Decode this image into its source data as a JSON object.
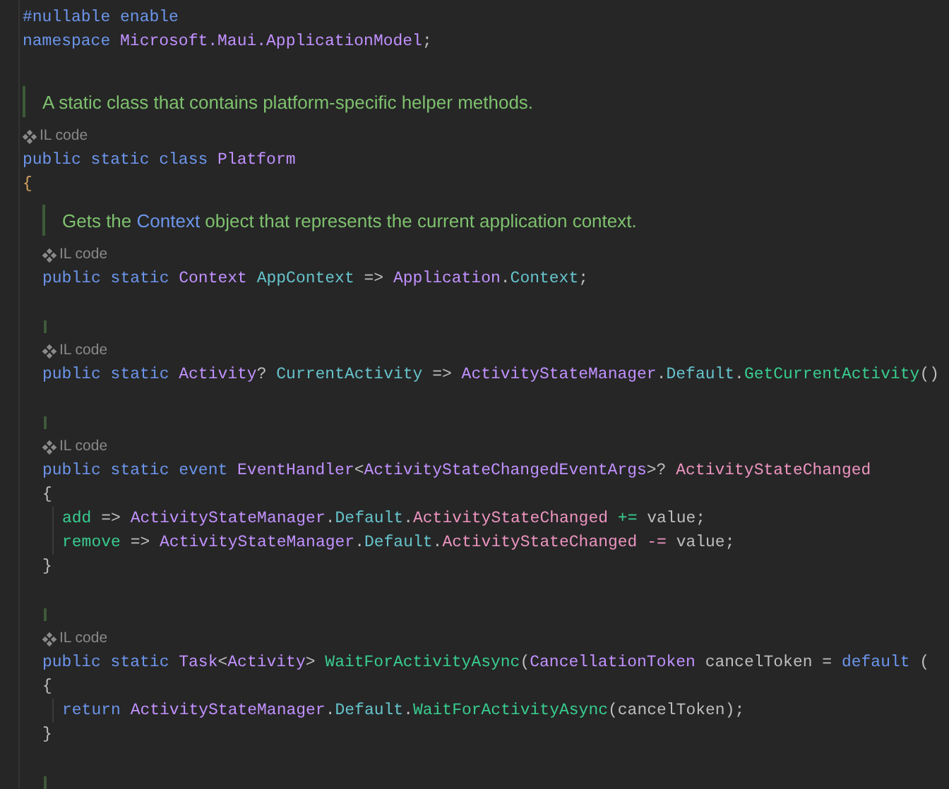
{
  "lines": [
    {
      "kind": "code",
      "tokens": [
        {
          "kind": "keyword",
          "text": "#nullable enable"
        }
      ]
    },
    {
      "kind": "code",
      "tokens": [
        {
          "kind": "keyword",
          "text": "namespace "
        },
        {
          "kind": "type",
          "text": "Microsoft.Maui.ApplicationModel"
        },
        {
          "kind": "plain",
          "text": ";"
        }
      ]
    },
    {
      "kind": "blank"
    },
    {
      "kind": "doc",
      "tokens": [
        {
          "kind": "text",
          "text": "A static class that contains platform-specific helper methods."
        }
      ]
    },
    {
      "kind": "hint",
      "text": "IL code"
    },
    {
      "kind": "code",
      "tokens": [
        {
          "kind": "keyword",
          "text": "public static class "
        },
        {
          "kind": "type",
          "text": "Platform"
        }
      ]
    },
    {
      "kind": "code",
      "tokens": [
        {
          "kind": "brace",
          "text": "{"
        }
      ]
    },
    {
      "kind": "block",
      "children": [
        {
          "kind": "doc",
          "tokens": [
            {
              "kind": "text",
              "text": "Gets the "
            },
            {
              "kind": "link",
              "text": "Context"
            },
            {
              "kind": "text",
              "text": " object that represents the current application context."
            }
          ]
        },
        {
          "kind": "hint",
          "text": "IL code"
        },
        {
          "kind": "code",
          "tokens": [
            {
              "kind": "keyword",
              "text": "public static "
            },
            {
              "kind": "type",
              "text": "Context "
            },
            {
              "kind": "member",
              "text": "AppContext"
            },
            {
              "kind": "plain",
              "text": " => "
            },
            {
              "kind": "type",
              "text": "Application"
            },
            {
              "kind": "plain",
              "text": "."
            },
            {
              "kind": "member",
              "text": "Context"
            },
            {
              "kind": "plain",
              "text": ";"
            }
          ]
        },
        {
          "kind": "blank"
        },
        {
          "kind": "marker"
        },
        {
          "kind": "hint",
          "text": "IL code"
        },
        {
          "kind": "code",
          "tokens": [
            {
              "kind": "keyword",
              "text": "public static "
            },
            {
              "kind": "type",
              "text": "Activity"
            },
            {
              "kind": "plain",
              "text": "? "
            },
            {
              "kind": "member",
              "text": "CurrentActivity"
            },
            {
              "kind": "plain",
              "text": " => "
            },
            {
              "kind": "type",
              "text": "ActivityStateManager"
            },
            {
              "kind": "plain",
              "text": "."
            },
            {
              "kind": "member",
              "text": "Default"
            },
            {
              "kind": "plain",
              "text": "."
            },
            {
              "kind": "method",
              "text": "GetCurrentActivity"
            },
            {
              "kind": "plain",
              "text": "()"
            }
          ]
        },
        {
          "kind": "blank"
        },
        {
          "kind": "marker"
        },
        {
          "kind": "hint",
          "text": "IL code"
        },
        {
          "kind": "code",
          "tokens": [
            {
              "kind": "keyword",
              "text": "public static event "
            },
            {
              "kind": "type",
              "text": "EventHandler"
            },
            {
              "kind": "plain",
              "text": "<"
            },
            {
              "kind": "type",
              "text": "ActivityStateChangedEventArgs"
            },
            {
              "kind": "plain",
              "text": ">? "
            },
            {
              "kind": "event",
              "text": "ActivityStateChanged"
            }
          ]
        },
        {
          "kind": "code",
          "tokens": [
            {
              "kind": "plain",
              "text": "{"
            }
          ]
        },
        {
          "kind": "block",
          "children": [
            {
              "kind": "code",
              "tokens": [
                {
                  "kind": "accessor",
                  "text": "add"
                },
                {
                  "kind": "plain",
                  "text": " => "
                },
                {
                  "kind": "type",
                  "text": "ActivityStateManager"
                },
                {
                  "kind": "plain",
                  "text": "."
                },
                {
                  "kind": "member",
                  "text": "Default"
                },
                {
                  "kind": "plain",
                  "text": "."
                },
                {
                  "kind": "event",
                  "text": "ActivityStateChanged"
                },
                {
                  "kind": "accessor",
                  "text": " += "
                },
                {
                  "kind": "plain",
                  "text": "value;"
                }
              ]
            },
            {
              "kind": "code",
              "tokens": [
                {
                  "kind": "accessor",
                  "text": "remove"
                },
                {
                  "kind": "plain",
                  "text": " => "
                },
                {
                  "kind": "type",
                  "text": "ActivityStateManager"
                },
                {
                  "kind": "plain",
                  "text": "."
                },
                {
                  "kind": "member",
                  "text": "Default"
                },
                {
                  "kind": "plain",
                  "text": "."
                },
                {
                  "kind": "event",
                  "text": "ActivityStateChanged"
                },
                {
                  "kind": "event",
                  "text": " -= "
                },
                {
                  "kind": "plain",
                  "text": "value;"
                }
              ]
            }
          ]
        },
        {
          "kind": "code",
          "tokens": [
            {
              "kind": "plain",
              "text": "}"
            }
          ]
        },
        {
          "kind": "blank"
        },
        {
          "kind": "marker"
        },
        {
          "kind": "hint",
          "text": "IL code"
        },
        {
          "kind": "code",
          "tokens": [
            {
              "kind": "keyword",
              "text": "public static "
            },
            {
              "kind": "type",
              "text": "Task"
            },
            {
              "kind": "plain",
              "text": "<"
            },
            {
              "kind": "type",
              "text": "Activity"
            },
            {
              "kind": "plain",
              "text": "> "
            },
            {
              "kind": "method",
              "text": "WaitForActivityAsync"
            },
            {
              "kind": "plain",
              "text": "("
            },
            {
              "kind": "type",
              "text": "CancellationToken"
            },
            {
              "kind": "plain",
              "text": " cancelToken = "
            },
            {
              "kind": "keyword",
              "text": "default"
            },
            {
              "kind": "plain",
              "text": " ("
            }
          ]
        },
        {
          "kind": "code",
          "tokens": [
            {
              "kind": "plain",
              "text": "{"
            }
          ]
        },
        {
          "kind": "block",
          "children": [
            {
              "kind": "code",
              "tokens": [
                {
                  "kind": "keyword",
                  "text": "return "
                },
                {
                  "kind": "type",
                  "text": "ActivityStateManager"
                },
                {
                  "kind": "plain",
                  "text": "."
                },
                {
                  "kind": "member",
                  "text": "Default"
                },
                {
                  "kind": "plain",
                  "text": "."
                },
                {
                  "kind": "method",
                  "text": "WaitForActivityAsync"
                },
                {
                  "kind": "plain",
                  "text": "(cancelToken);"
                }
              ]
            }
          ]
        },
        {
          "kind": "code",
          "tokens": [
            {
              "kind": "plain",
              "text": "}"
            }
          ]
        },
        {
          "kind": "blank"
        },
        {
          "kind": "marker"
        }
      ]
    }
  ]
}
